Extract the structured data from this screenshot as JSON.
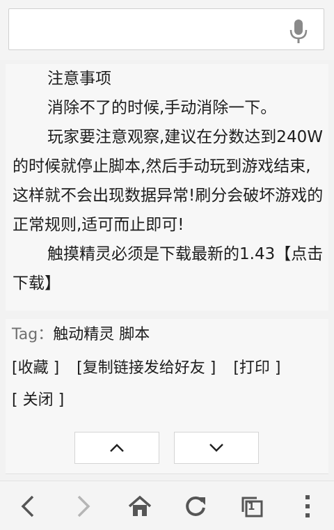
{
  "search": {
    "value": "",
    "placeholder": ""
  },
  "article": {
    "lines": [
      "注意事项",
      "消除不了的时候,手动消除一下。",
      "玩家要注意观察,建议在分数达到240W的时候就停止脚本,然后手动玩到游戏结束,这样就不会出现数据异常!刷分会破坏游戏的正常规则,适可而止即可!",
      "触摸精灵必须是下载最新的1.43【点击下载】"
    ]
  },
  "tags": {
    "label": "Tag：",
    "items": "触动精灵 脚本"
  },
  "actions": {
    "favorite": "[收藏 ]",
    "copy_link": "[复制链接发给好友 ]",
    "print": "[打印 ]",
    "close": "[ 关闭 ]"
  },
  "icons": {
    "mic": "microphone-icon",
    "up": "chevron-up-icon",
    "down": "chevron-down-icon",
    "back": "back-icon",
    "forward": "forward-icon",
    "home": "home-icon",
    "refresh": "refresh-icon",
    "tabs": "tabs-icon",
    "menu": "menu-icon"
  },
  "toolbar": {
    "tab_count": "1"
  },
  "colors": {
    "icon": "#555555",
    "icon_disabled": "#b5b5b5"
  }
}
